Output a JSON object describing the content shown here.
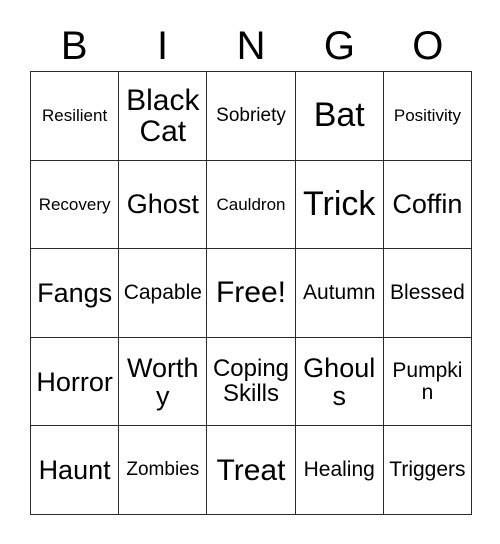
{
  "card": {
    "title_letters": [
      "B",
      "I",
      "N",
      "G",
      "O"
    ],
    "free_space_label": "Free!",
    "border_color": "#2b2b2b",
    "background_color": "#ffffff",
    "text_color": "#000000",
    "rows": [
      [
        {
          "label": "Resilient",
          "size": "fs-xs"
        },
        {
          "label": "Black Cat",
          "size": "fs-xxl"
        },
        {
          "label": "Sobriety",
          "size": "fs-s"
        },
        {
          "label": "Bat",
          "size": "fs-huge"
        },
        {
          "label": "Positivity",
          "size": "fs-xs"
        }
      ],
      [
        {
          "label": "Recovery",
          "size": "fs-xs"
        },
        {
          "label": "Ghost",
          "size": "fs-xl"
        },
        {
          "label": "Cauldron",
          "size": "fs-xs"
        },
        {
          "label": "Trick",
          "size": "fs-huge"
        },
        {
          "label": "Coffin",
          "size": "fs-xl"
        }
      ],
      [
        {
          "label": "Fangs",
          "size": "fs-xl"
        },
        {
          "label": "Capable",
          "size": "fs-m"
        },
        {
          "label": "Free!",
          "size": "fs-xxl"
        },
        {
          "label": "Autumn",
          "size": "fs-m"
        },
        {
          "label": "Blessed",
          "size": "fs-m"
        }
      ],
      [
        {
          "label": "Horror",
          "size": "fs-xl"
        },
        {
          "label": "Worthy",
          "size": "fs-xl"
        },
        {
          "label": "Coping Skills",
          "size": "fs-l"
        },
        {
          "label": "Ghouls",
          "size": "fs-xl"
        },
        {
          "label": "Pumpkin",
          "size": "fs-m"
        }
      ],
      [
        {
          "label": "Haunt",
          "size": "fs-xl"
        },
        {
          "label": "Zombies",
          "size": "fs-s"
        },
        {
          "label": "Treat",
          "size": "fs-xxl"
        },
        {
          "label": "Healing",
          "size": "fs-m"
        },
        {
          "label": "Triggers",
          "size": "fs-m"
        }
      ]
    ]
  }
}
